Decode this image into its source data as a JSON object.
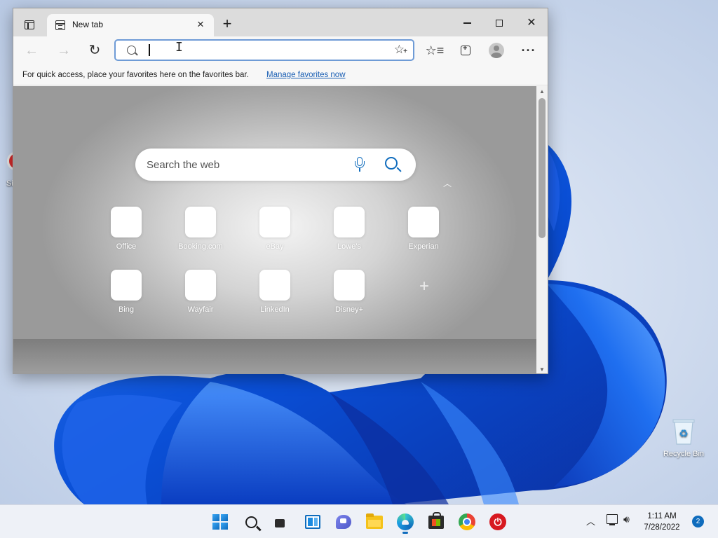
{
  "browser": {
    "tab": {
      "title": "New tab"
    },
    "address_bar": {
      "value": "",
      "placeholder": ""
    },
    "favorites_bar": {
      "message": "For quick access, place your favorites here on the favorites bar.",
      "link": "Manage favorites now"
    },
    "new_tab_page": {
      "search": {
        "placeholder": "Search the web"
      },
      "quick_links": [
        {
          "label": "Office"
        },
        {
          "label": "Booking.com"
        },
        {
          "label": "eBay"
        },
        {
          "label": "Lowe's"
        },
        {
          "label": "Experian"
        },
        {
          "label": "Bing"
        },
        {
          "label": "Wayfair"
        },
        {
          "label": "LinkedIn"
        },
        {
          "label": "Disney+"
        }
      ]
    }
  },
  "desktop": {
    "icons": [
      {
        "label": "Recycle Bin",
        "icon": "recycle-bin-icon"
      },
      {
        "label": "Si",
        "icon": "app-icon"
      }
    ]
  },
  "taskbar": {
    "apps": [
      {
        "name": "start",
        "icon": "windows-logo-icon"
      },
      {
        "name": "search",
        "icon": "search-icon"
      },
      {
        "name": "task-view",
        "icon": "task-view-icon"
      },
      {
        "name": "widgets",
        "icon": "widgets-icon"
      },
      {
        "name": "chat",
        "icon": "teams-chat-icon"
      },
      {
        "name": "file-explorer",
        "icon": "folder-icon"
      },
      {
        "name": "edge",
        "icon": "edge-icon",
        "active": true
      },
      {
        "name": "store",
        "icon": "store-icon"
      },
      {
        "name": "chrome",
        "icon": "chrome-icon"
      },
      {
        "name": "power-app",
        "icon": "power-icon"
      }
    ],
    "clock": {
      "time": "1:11 AM",
      "date": "7/28/2022"
    },
    "notification_count": "2"
  },
  "colors": {
    "accent": "#0f6cbd",
    "link": "#1a5fb4",
    "wallpaper_blue": "#0a4fd6"
  }
}
